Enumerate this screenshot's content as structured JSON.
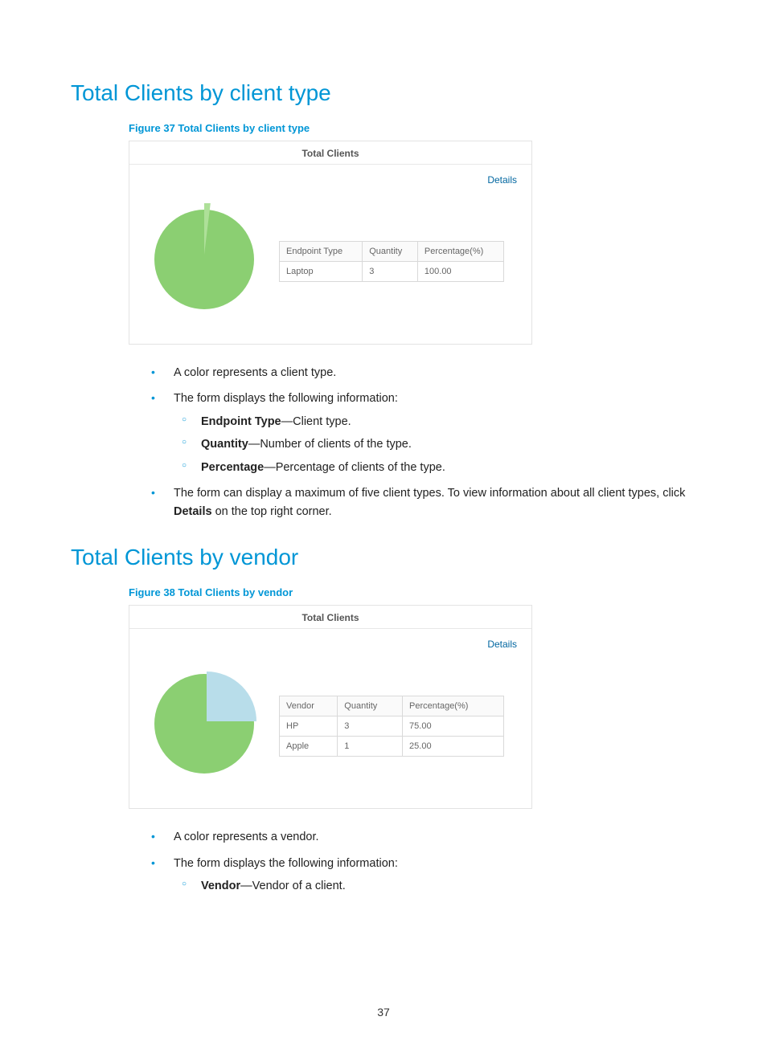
{
  "page_number": "37",
  "section1": {
    "heading": "Total Clients by client type",
    "figure_caption": "Figure 37 Total Clients by client type",
    "panel_title": "Total Clients",
    "details_label": "Details",
    "columns": {
      "c1": "Endpoint Type",
      "c2": "Quantity",
      "c3": "Percentage(%)"
    },
    "rows": [
      {
        "c1": "Laptop",
        "c2": "3",
        "c3": "100.00"
      }
    ],
    "bullets": {
      "b1": "A color represents a client type.",
      "b2": "The form displays the following information:",
      "sub": {
        "s1_label": "Endpoint Type",
        "s1_rest": "—Client type.",
        "s2_label": "Quantity",
        "s2_rest": "—Number of clients of the type.",
        "s3_label": "Percentage",
        "s3_rest": "—Percentage of clients of the type."
      },
      "b3_pre": "The form can display a maximum of five client types. To view information about all client types, click ",
      "b3_bold": "Details",
      "b3_post": " on the top right corner."
    }
  },
  "section2": {
    "heading": "Total Clients by vendor",
    "figure_caption": "Figure 38 Total Clients by vendor",
    "panel_title": "Total Clients",
    "details_label": "Details",
    "columns": {
      "c1": "Vendor",
      "c2": "Quantity",
      "c3": "Percentage(%)"
    },
    "rows": [
      {
        "c1": "HP",
        "c2": "3",
        "c3": "75.00"
      },
      {
        "c1": "Apple",
        "c2": "1",
        "c3": "25.00"
      }
    ],
    "bullets": {
      "b1": "A color represents a vendor.",
      "b2": "The form displays the following information:",
      "sub": {
        "s1_label": "Vendor",
        "s1_rest": "—Vendor of a client."
      }
    }
  },
  "chart_data": [
    {
      "type": "pie",
      "title": "Total Clients",
      "series": [
        {
          "name": "Laptop",
          "value": 3,
          "percent": 100.0,
          "color": "#8bcf72"
        }
      ],
      "has_highlight_sliver": true
    },
    {
      "type": "pie",
      "title": "Total Clients",
      "series": [
        {
          "name": "HP",
          "value": 3,
          "percent": 75.0,
          "color": "#8bcf72"
        },
        {
          "name": "Apple",
          "value": 1,
          "percent": 25.0,
          "color": "#b8ddea"
        }
      ]
    }
  ]
}
